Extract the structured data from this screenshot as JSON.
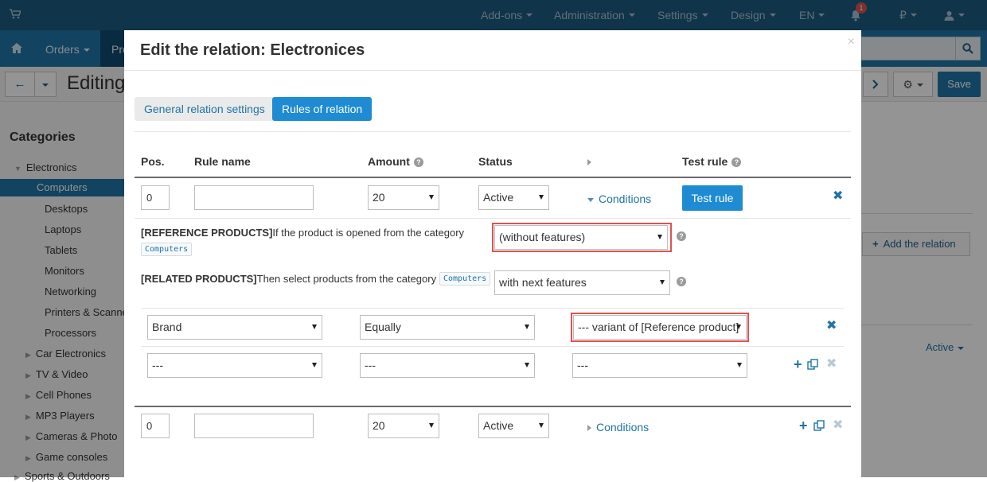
{
  "topbar": {
    "nav": [
      "Add-ons",
      "Administration",
      "Settings",
      "Design",
      "EN"
    ],
    "notification_count": "1",
    "currency_symbol": "₽"
  },
  "navbar": {
    "orders_label": "Orders",
    "products_label_fragment": "Pro"
  },
  "toolbar": {
    "title_fragment": "Editing",
    "save_label": "Save"
  },
  "sidebar": {
    "title": "Categories",
    "items": [
      {
        "label": "Electronics",
        "level": 0,
        "expanded": true
      },
      {
        "label": "Computers",
        "level": 1,
        "active": true
      },
      {
        "label": "Desktops",
        "level": 2
      },
      {
        "label": "Laptops",
        "level": 2
      },
      {
        "label": "Tablets",
        "level": 2
      },
      {
        "label": "Monitors",
        "level": 2
      },
      {
        "label": "Networking",
        "level": 2
      },
      {
        "label": "Printers & Scanners",
        "level": 2
      },
      {
        "label": "Processors",
        "level": 2
      },
      {
        "label": "Car Electronics",
        "level": 1
      },
      {
        "label": "TV & Video",
        "level": 1
      },
      {
        "label": "Cell Phones",
        "level": 1
      },
      {
        "label": "MP3 Players",
        "level": 1
      },
      {
        "label": "Cameras & Photo",
        "level": 1
      },
      {
        "label": "Game consoles",
        "level": 1
      },
      {
        "label": "Sports & Outdoors",
        "level": 0
      }
    ]
  },
  "background_right": {
    "add_relation_label": "Add the relation",
    "status_label": "Active"
  },
  "modal": {
    "title": "Edit the relation: Electronices",
    "tabs": [
      {
        "label": "General relation settings",
        "active": false
      },
      {
        "label": "Rules of relation",
        "active": true
      }
    ],
    "columns": [
      "Pos.",
      "Rule name",
      "Amount",
      "Status",
      "",
      "Test rule"
    ],
    "rules": [
      {
        "pos": "0",
        "name": "",
        "amount": "20",
        "status": "Active",
        "conditions_label": "Conditions",
        "expanded": true,
        "test_button_label": "Test rule"
      },
      {
        "pos": "0",
        "name": "",
        "amount": "20",
        "status": "Active",
        "conditions_label": "Conditions",
        "expanded": false
      }
    ],
    "conditions": {
      "reference": {
        "prefix": "[REFERENCE PRODUCTS]",
        "text": "If the product is opened from the category",
        "category_tag": "Computers",
        "select_value": "(without features)"
      },
      "related": {
        "prefix": "[RELATED PRODUCTS]",
        "text": "Then select products from the category",
        "category_tag": "Computers",
        "select_value": "with next features"
      },
      "feature_rows": [
        {
          "feature": "Brand",
          "operator": "Equally",
          "value": "--- variant of [Reference product]"
        },
        {
          "feature": "---",
          "operator": "---",
          "value": "---"
        }
      ]
    },
    "colors": {
      "primary": "#1e8bd3",
      "link": "#1f74a6",
      "highlight": "#e05252"
    }
  }
}
